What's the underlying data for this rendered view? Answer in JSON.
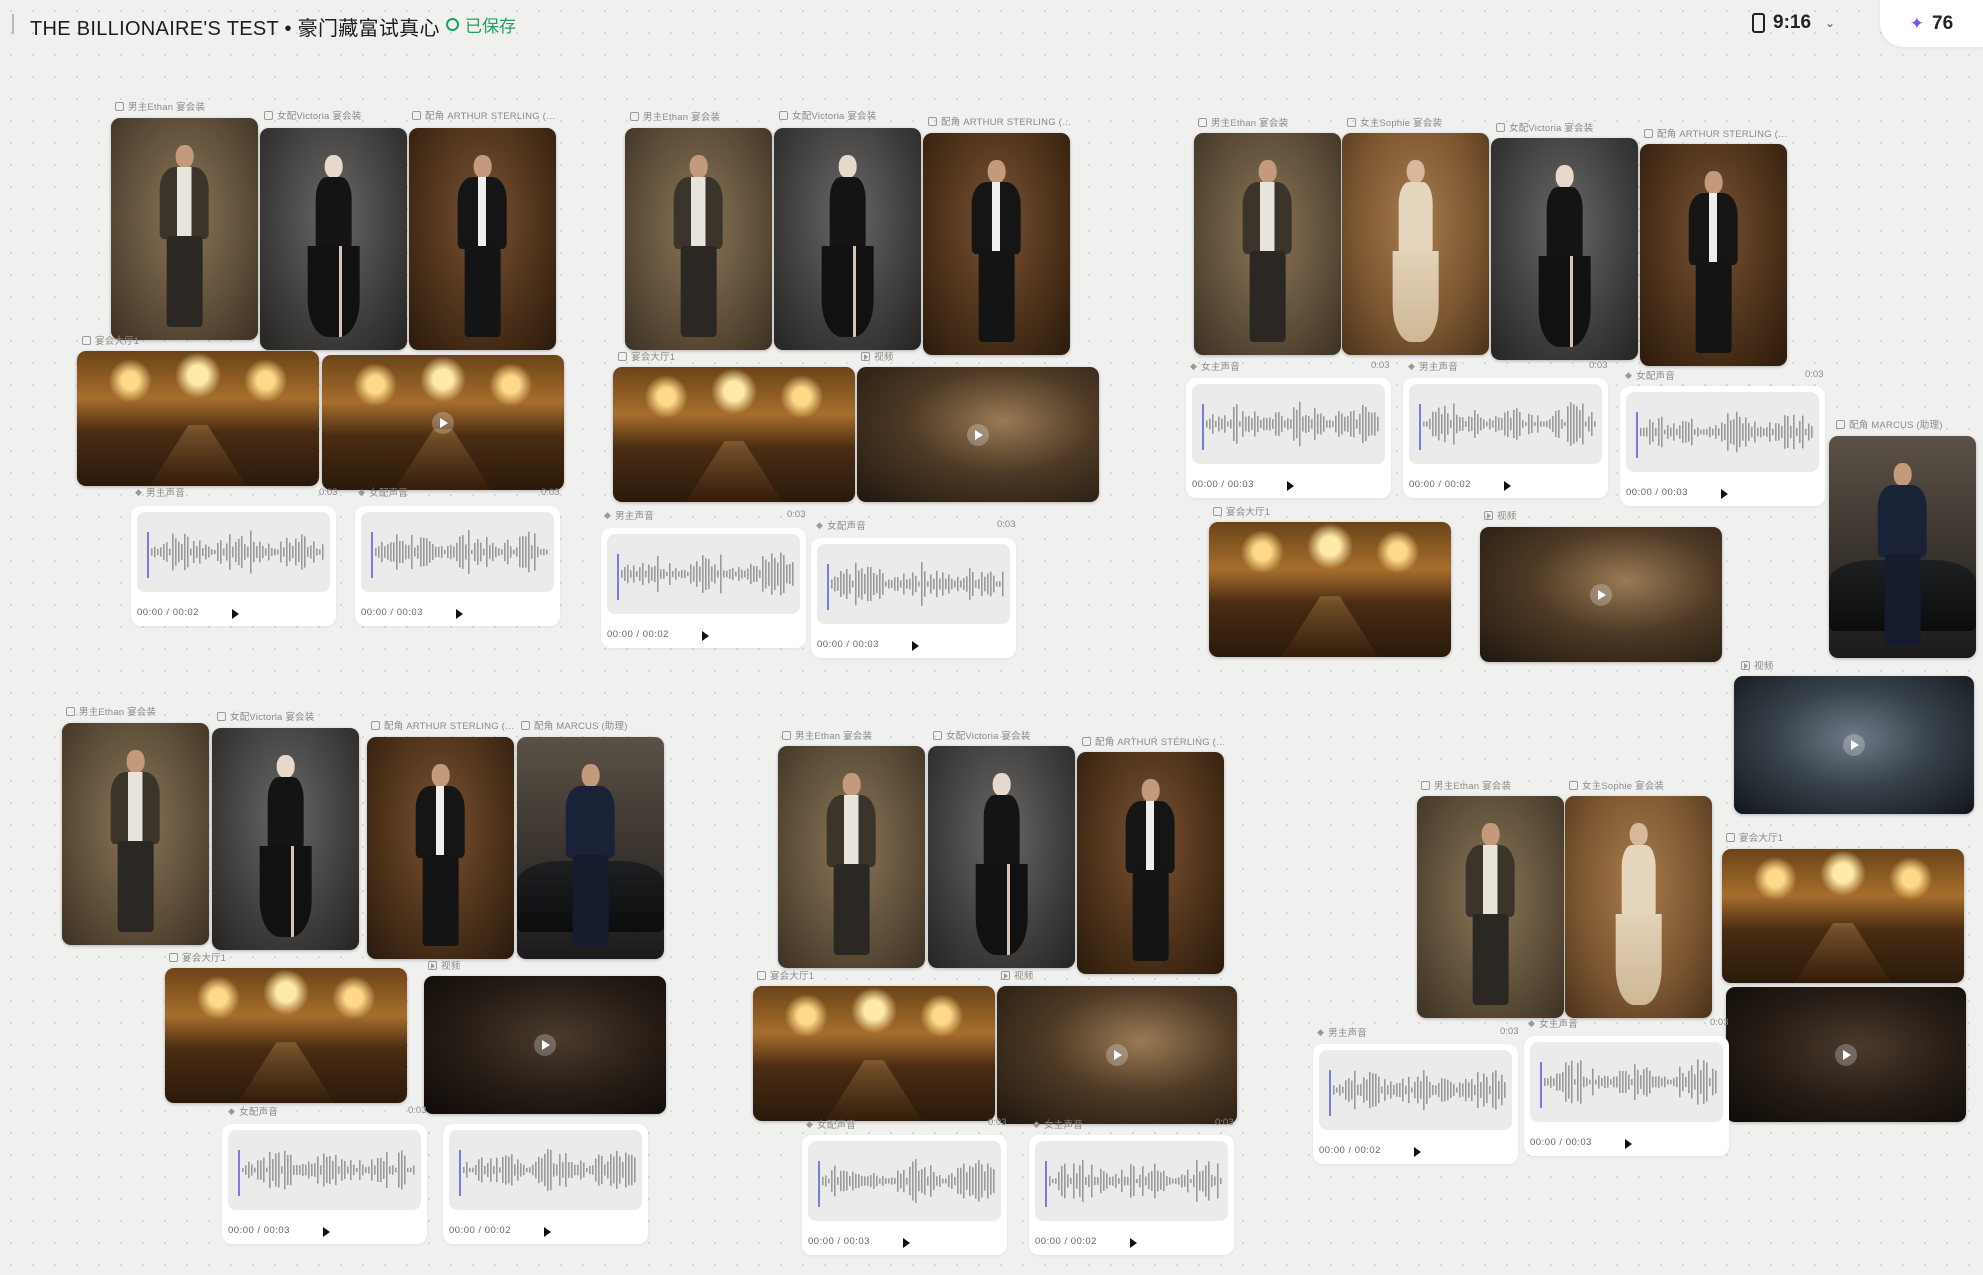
{
  "header": {
    "title": "THE BILLIONAIRE'S TEST  •  豪门藏富试真心",
    "saved": "已保存",
    "timer": "9:16",
    "credits": "76",
    "credits_icon": "sparkle-icon",
    "colors": {
      "saved": "#1fa35a",
      "credits_icon": "#7b4dff"
    }
  },
  "labels": {
    "ethan": "男主Ethan 宴会装",
    "victoria": "女配Victoria 宴会装",
    "arthur": "配角 ARTHUR STERLING (…",
    "sophie": "女主Sophie 宴会装",
    "marcus": "配角 MARCUS (助理)",
    "hall": "宴会大厅1",
    "video": "视频",
    "male_voice": "男主声音",
    "female_voice": "女主声音",
    "victoria_voice": "女配声音"
  },
  "audio_times": {
    "t2": "00:00 / 00:02",
    "t3": "00:00 / 00:03"
  },
  "durations": {
    "d3": "0:03"
  }
}
